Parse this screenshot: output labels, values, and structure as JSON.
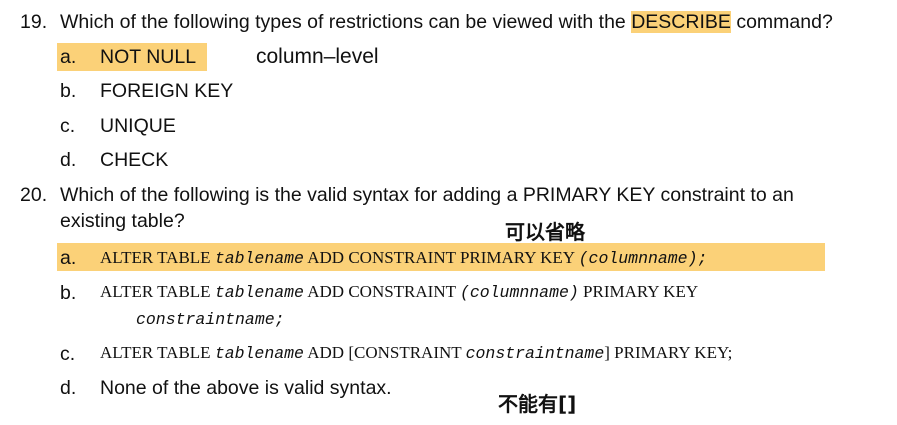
{
  "q19": {
    "number": "19.",
    "text_before": "Which of the following types of restrictions can be viewed with the",
    "keyword": "DESCRIBE",
    "text_after": "command?",
    "options": [
      {
        "letter": "a.",
        "text": "NOT NULL"
      },
      {
        "letter": "b.",
        "text": "FOREIGN KEY"
      },
      {
        "letter": "c.",
        "text": "UNIQUE"
      },
      {
        "letter": "d.",
        "text": "CHECK"
      }
    ],
    "note": "column–level"
  },
  "q20": {
    "number": "20.",
    "line1": "Which of the following is the valid syntax for adding a PRIMARY KEY constraint to an",
    "line2": "existing table?",
    "note1": "可以省略",
    "note2": "不能有[]",
    "a": {
      "letter": "a.",
      "p1": "ALTER TABLE ",
      "p2": "tablename",
      "p3": " ADD CONSTRAINT PRIMARY KEY ",
      "p4": "(columnname);"
    },
    "b": {
      "letter": "b.",
      "p1": "ALTER TABLE ",
      "p2": "tablename",
      "p3": " ADD CONSTRAINT ",
      "p4": "(columnname)",
      "p5": " PRIMARY KEY",
      "p6": "constraintname;"
    },
    "c": {
      "letter": "c.",
      "p1": "ALTER TABLE ",
      "p2": "tablename",
      "p3": " ADD [CONSTRAINT ",
      "p4": "constraintname",
      "p5": "] PRIMARY KEY;"
    },
    "d": {
      "letter": "d.",
      "text": "None of the above is valid syntax."
    }
  },
  "colors": {
    "highlight": "#fbd178",
    "text": "#111111"
  }
}
